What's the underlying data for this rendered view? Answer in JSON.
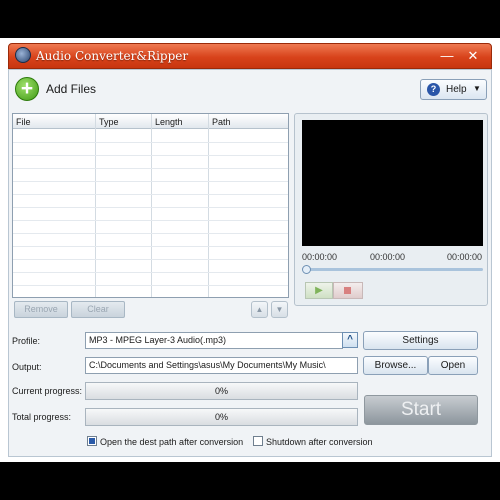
{
  "window": {
    "title": "Audio Converter&Ripper",
    "minimize": "—",
    "close": "✕"
  },
  "toolbar": {
    "add_files": "Add Files",
    "help": "Help"
  },
  "file_list": {
    "columns": [
      "File",
      "Type",
      "Length",
      "Path"
    ],
    "rows": [],
    "remove": "Remove",
    "clear": "Clear"
  },
  "player": {
    "time_start": "00:00:00",
    "time_mid": "00:00:00",
    "time_end": "00:00:00",
    "position": 0
  },
  "form": {
    "profile_label": "Profile:",
    "profile_value": "MP3 - MPEG Layer-3 Audio(.mp3)",
    "settings": "Settings",
    "output_label": "Output:",
    "output_value": "C:\\Documents and Settings\\asus\\My Documents\\My Music\\",
    "browse": "Browse...",
    "open": "Open",
    "current_label": "Current progress:",
    "current_value": "0%",
    "total_label": "Total progress:",
    "total_value": "0%",
    "start": "Start",
    "open_dest_label": "Open the dest path after conversion",
    "open_dest_checked": true,
    "shutdown_label": "Shutdown after conversion",
    "shutdown_checked": false
  }
}
